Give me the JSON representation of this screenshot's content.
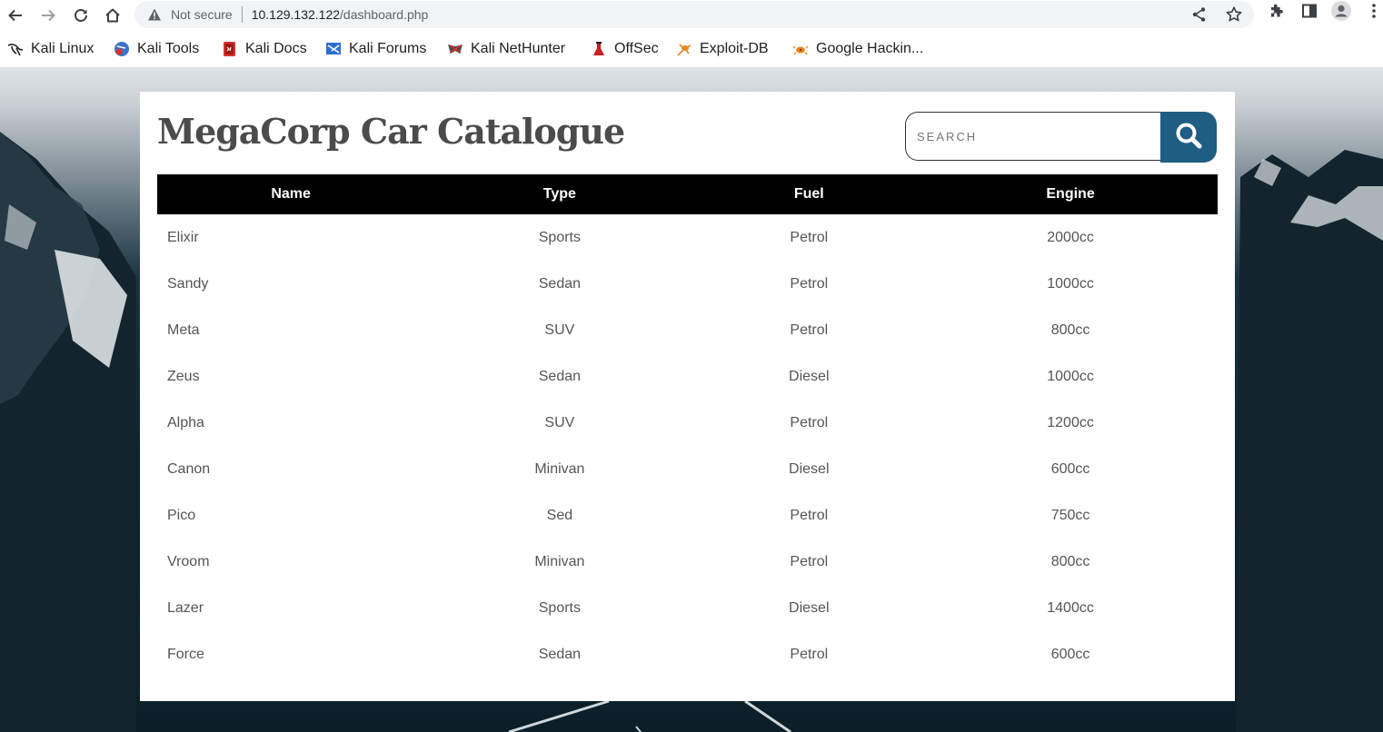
{
  "browser": {
    "security_label": "Not secure",
    "url_host": "10.129.132.122",
    "url_path": "/dashboard.php",
    "bookmarks": [
      {
        "label": "Kali Linux",
        "icon": "kali-dragon-icon"
      },
      {
        "label": "Kali Tools",
        "icon": "kali-tools-icon"
      },
      {
        "label": "Kali Docs",
        "icon": "kali-docs-icon"
      },
      {
        "label": "Kali Forums",
        "icon": "kali-forums-icon"
      },
      {
        "label": "Kali NetHunter",
        "icon": "kali-nethunter-icon"
      },
      {
        "label": "OffSec",
        "icon": "offsec-icon"
      },
      {
        "label": "Exploit-DB",
        "icon": "exploit-db-icon"
      },
      {
        "label": "Google Hackin...",
        "icon": "google-hacking-icon"
      }
    ]
  },
  "page": {
    "title": "MegaCorp Car Catalogue",
    "search": {
      "placeholder": "SEARCH",
      "value": ""
    },
    "accent_color": "#1f5d82",
    "table": {
      "headers": [
        "Name",
        "Type",
        "Fuel",
        "Engine"
      ],
      "rows": [
        [
          "Elixir",
          "Sports",
          "Petrol",
          "2000cc"
        ],
        [
          "Sandy",
          "Sedan",
          "Petrol",
          "1000cc"
        ],
        [
          "Meta",
          "SUV",
          "Petrol",
          "800cc"
        ],
        [
          "Zeus",
          "Sedan",
          "Diesel",
          "1000cc"
        ],
        [
          "Alpha",
          "SUV",
          "Petrol",
          "1200cc"
        ],
        [
          "Canon",
          "Minivan",
          "Diesel",
          "600cc"
        ],
        [
          "Pico",
          "Sed",
          "Petrol",
          "750cc"
        ],
        [
          "Vroom",
          "Minivan",
          "Petrol",
          "800cc"
        ],
        [
          "Lazer",
          "Sports",
          "Diesel",
          "1400cc"
        ],
        [
          "Force",
          "Sedan",
          "Petrol",
          "600cc"
        ]
      ]
    }
  }
}
